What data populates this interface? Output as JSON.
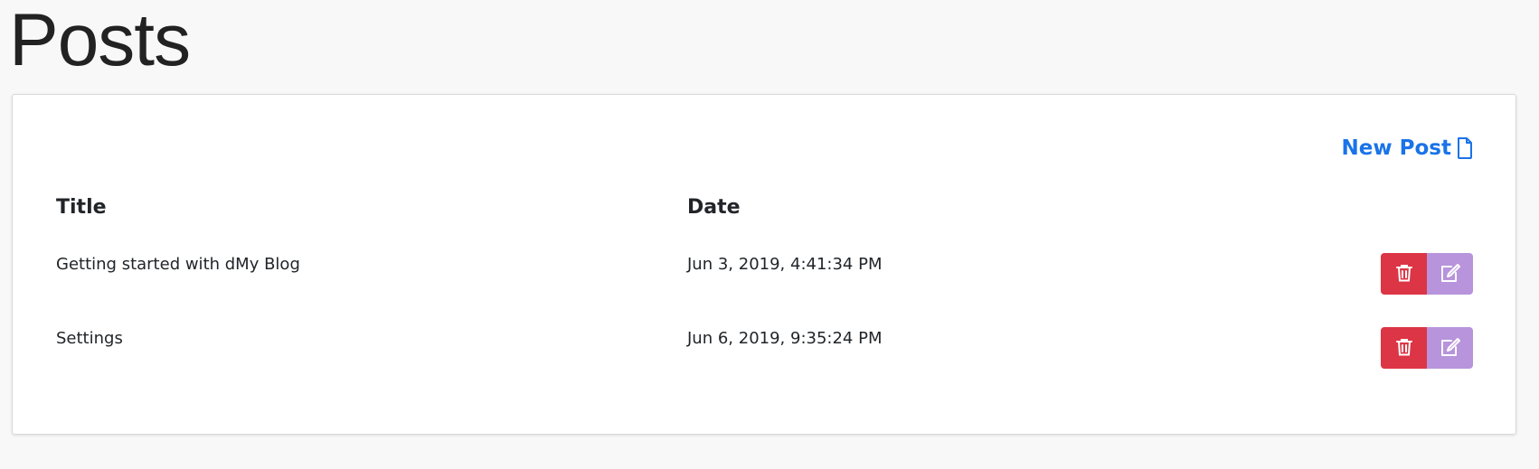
{
  "page": {
    "title": "Posts"
  },
  "toolbar": {
    "new_post_label": "New Post",
    "new_post_icon": "file-icon"
  },
  "table": {
    "columns": [
      "Title",
      "Date"
    ],
    "rows": [
      {
        "title": "Getting started with dMy Blog",
        "date": "Jun 3, 2019, 4:41:34 PM"
      },
      {
        "title": "Settings",
        "date": "Jun 6, 2019, 9:35:24 PM"
      }
    ],
    "row_actions": {
      "delete_icon": "trash-icon",
      "edit_icon": "edit-icon"
    }
  },
  "colors": {
    "accent": "#1a73e8",
    "danger": "#dc3545",
    "edit": "#b794db",
    "background": "#f8f8f8"
  }
}
